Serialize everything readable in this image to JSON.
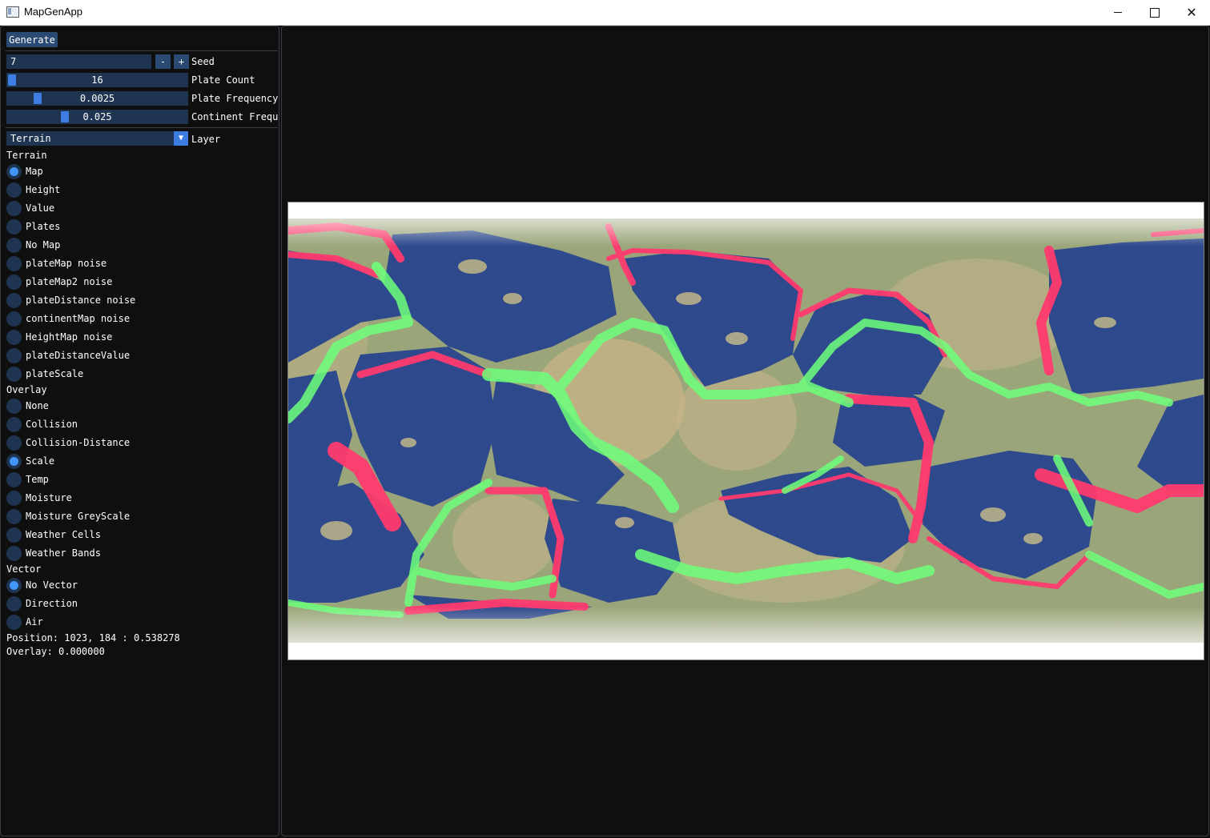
{
  "window": {
    "title": "MapGenApp",
    "minimize_icon": "minimize-icon",
    "maximize_icon": "maximize-icon",
    "close_glyph": "✕"
  },
  "panel": {
    "generate_label": "Generate",
    "seed": {
      "value": "7",
      "minus": "-",
      "plus": "+",
      "label": "Seed"
    },
    "plate_count": {
      "value": "16",
      "fraction": 0.0,
      "label": "Plate Count"
    },
    "plate_frequency": {
      "value": "0.0025",
      "fraction": 0.15,
      "label": "Plate Frequency"
    },
    "continent_frequency": {
      "value": "0.025",
      "fraction": 0.31,
      "label": "Continent Frequency"
    },
    "layer": {
      "value": "Terrain",
      "label": "Layer",
      "arrow": "▼"
    },
    "terrain_header": "Terrain",
    "terrain_options": [
      {
        "label": "Map",
        "selected": true
      },
      {
        "label": "Height",
        "selected": false
      },
      {
        "label": "Value",
        "selected": false
      },
      {
        "label": "Plates",
        "selected": false
      },
      {
        "label": "No Map",
        "selected": false
      },
      {
        "label": "plateMap noise",
        "selected": false
      },
      {
        "label": "plateMap2 noise",
        "selected": false
      },
      {
        "label": "plateDistance noise",
        "selected": false
      },
      {
        "label": "continentMap noise",
        "selected": false
      },
      {
        "label": "HeightMap noise",
        "selected": false
      },
      {
        "label": "plateDistanceValue",
        "selected": false
      },
      {
        "label": "plateScale",
        "selected": false
      }
    ],
    "overlay_header": "Overlay",
    "overlay_options": [
      {
        "label": "None",
        "selected": false
      },
      {
        "label": "Collision",
        "selected": false
      },
      {
        "label": "Collision-Distance",
        "selected": false
      },
      {
        "label": "Scale",
        "selected": true
      },
      {
        "label": "Temp",
        "selected": false
      },
      {
        "label": "Moisture",
        "selected": false
      },
      {
        "label": "Moisture GreyScale",
        "selected": false
      },
      {
        "label": "Weather Cells",
        "selected": false
      },
      {
        "label": "Weather Bands",
        "selected": false
      }
    ],
    "vector_header": "Vector",
    "vector_options": [
      {
        "label": "No Vector",
        "selected": true
      },
      {
        "label": "Direction",
        "selected": false
      },
      {
        "label": "Air",
        "selected": false
      }
    ],
    "position_text": "Position: 1023, 184 : 0.538278",
    "overlay_text": "Overlay: 0.000000"
  },
  "colors": {
    "ocean": "#2f4a8c",
    "land": "#9aa57a",
    "desert": "#c8b48a",
    "convergent": "#ff3a6e",
    "divergent": "#6dff7a",
    "accent": "#4296fa",
    "frame": "#2a4a73"
  }
}
